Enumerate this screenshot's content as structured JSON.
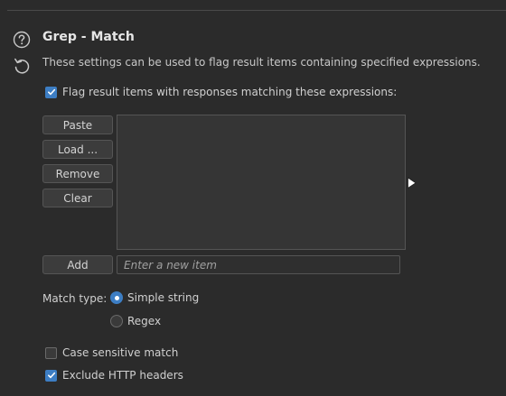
{
  "section": {
    "title": "Grep - Match",
    "description": "These settings can be used to flag result items containing specified expressions."
  },
  "flag_checkbox": {
    "label": "Flag result items with responses matching these expressions:",
    "checked": true
  },
  "list_buttons": {
    "paste": "Paste",
    "load": "Load ...",
    "remove": "Remove",
    "clear": "Clear",
    "add": "Add"
  },
  "expressions": [],
  "new_item": {
    "placeholder": "Enter a new item",
    "value": ""
  },
  "match_type": {
    "label": "Match type:",
    "options": [
      {
        "label": "Simple string",
        "selected": true
      },
      {
        "label": "Regex",
        "selected": false
      }
    ]
  },
  "options": {
    "case_sensitive": {
      "label": "Case sensitive match",
      "checked": false
    },
    "exclude_headers": {
      "label": "Exclude HTTP headers",
      "checked": true
    }
  },
  "icons": {
    "help": "help-circle-icon",
    "reset": "reset-icon",
    "checkmark": "checkmark-icon"
  },
  "colors": {
    "background": "#2b2b2b",
    "accent": "#3d7ec4",
    "text": "#d4d4d4"
  }
}
